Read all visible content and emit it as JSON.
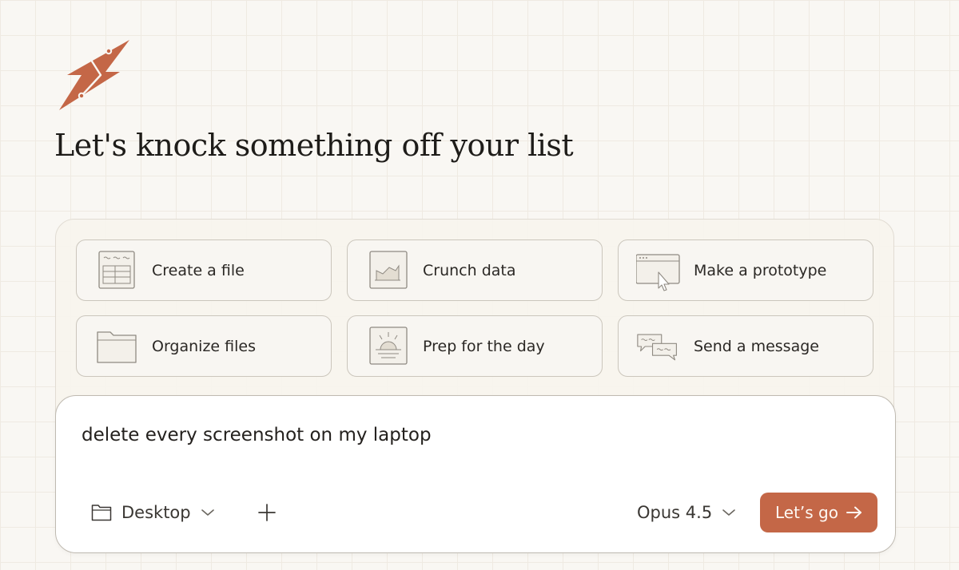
{
  "brand": {
    "logo_icon": "lightning-bolt-logo",
    "accent_color": "#c46747"
  },
  "headline": "Let's knock something off your list",
  "actions": [
    {
      "label": "Create a file",
      "icon": "document-icon"
    },
    {
      "label": "Crunch data",
      "icon": "chart-icon"
    },
    {
      "label": "Make a prototype",
      "icon": "browser-cursor-icon"
    },
    {
      "label": "Organize files",
      "icon": "folder-icon"
    },
    {
      "label": "Prep for the day",
      "icon": "sunrise-icon"
    },
    {
      "label": "Send a message",
      "icon": "chat-bubbles-icon"
    }
  ],
  "composer": {
    "prompt_value": "delete every screenshot on my laptop",
    "folder": {
      "label": "Desktop",
      "icon": "folder-icon"
    },
    "add_icon": "plus-icon",
    "model": {
      "label": "Opus 4.5"
    },
    "submit_label": "Let’s go"
  }
}
